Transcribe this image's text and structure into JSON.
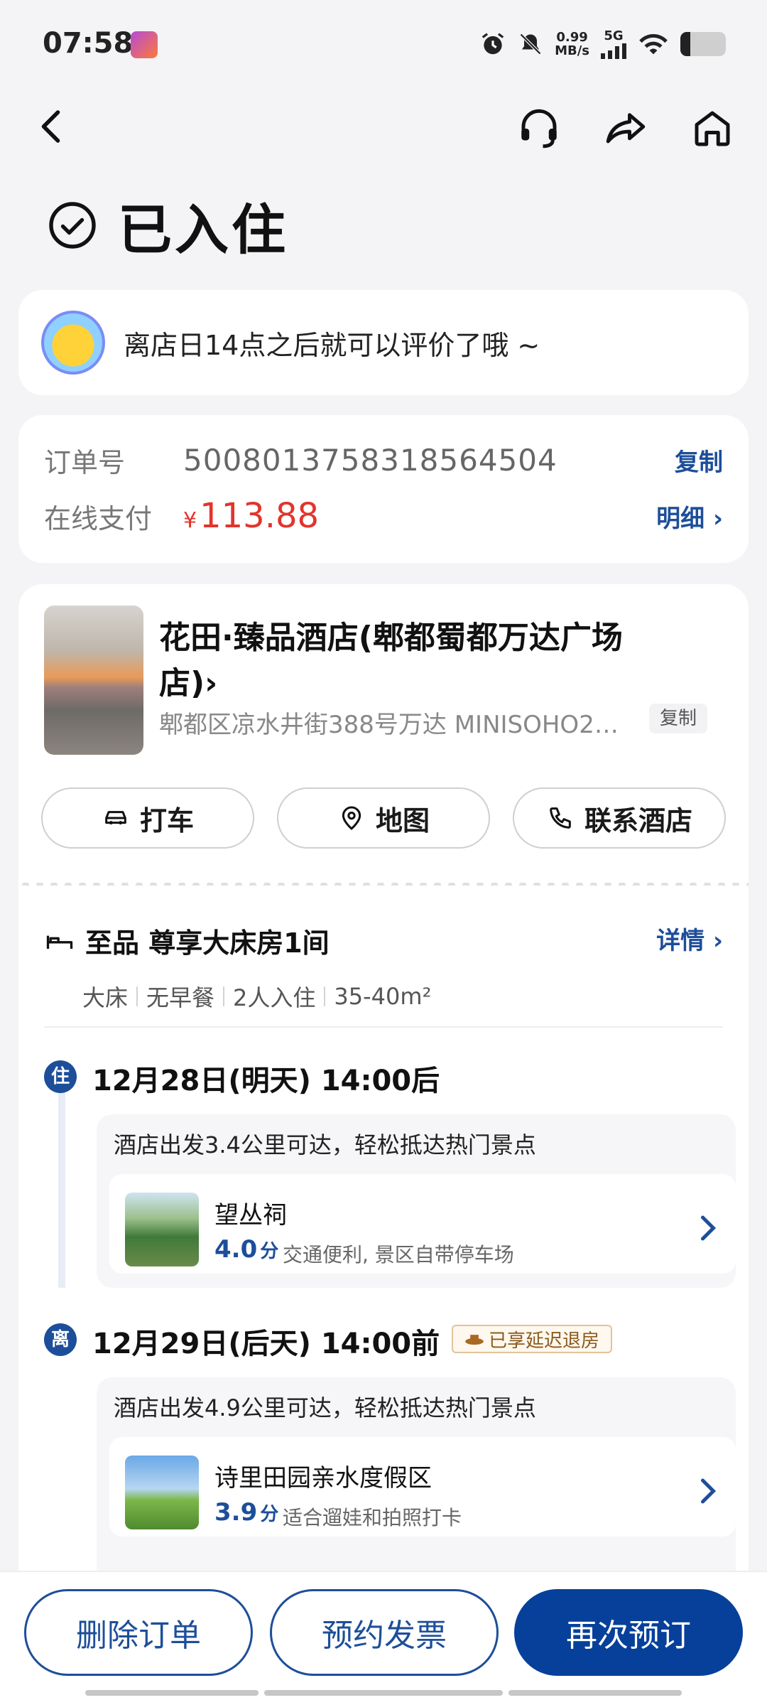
{
  "status_bar": {
    "time": "07:58",
    "net_speed_value": "0.99",
    "net_speed_unit": "MB/s",
    "network": "5G"
  },
  "nav": {
    "back_icon": "chevron-left-icon",
    "icons": [
      "headset-icon",
      "share-icon",
      "home-icon"
    ]
  },
  "page": {
    "status_title": "已入住"
  },
  "tip": {
    "text": "离店日14点之后就可以评价了哦 ~"
  },
  "order": {
    "order_no_label": "订单号",
    "order_no": "5008013758318564504",
    "copy_label": "复制",
    "payment_label": "在线支付",
    "currency": "¥",
    "amount": "113.88",
    "detail_label": "明细 ›"
  },
  "hotel": {
    "name": "花田·臻品酒店(郫都蜀都万达广场店)›",
    "address": "郫都区凉水井街388号万达 MINISOHO2…",
    "copy_label": "复制",
    "actions": {
      "taxi": "打车",
      "map": "地图",
      "contact": "联系酒店"
    }
  },
  "room": {
    "title": "至品 尊享大床房1间",
    "detail_link": "详情 ›",
    "tags": [
      "大床",
      "无早餐",
      "2人入住",
      "35-40m²"
    ]
  },
  "checkin": {
    "badge": "住",
    "date": "12月28日(明天) 14:00后",
    "nearby_title": "酒店出发3.4公里可达，轻松抵达热门景点",
    "attraction": {
      "name": "望丛祠",
      "score": "4.0",
      "score_unit": "分",
      "desc": "交通便利, 景区自带停车场"
    }
  },
  "checkout": {
    "badge": "离",
    "date": "12月29日(后天) 14:00前",
    "delay_badge": "已享延迟退房",
    "nearby_title": "酒店出发4.9公里可达，轻松抵达热门景点",
    "attraction": {
      "name": "诗里田园亲水度假区",
      "score": "3.9",
      "score_unit": "分",
      "desc": "适合遛娃和拍照打卡"
    }
  },
  "bottom_bar": {
    "delete_label": "删除订单",
    "invoice_label": "预约发票",
    "rebook_label": "再次预订"
  },
  "colors": {
    "accent": "#1d4e9a",
    "primary_button": "#06409a",
    "price_red": "#e2342c",
    "background": "#f4f4f6"
  }
}
